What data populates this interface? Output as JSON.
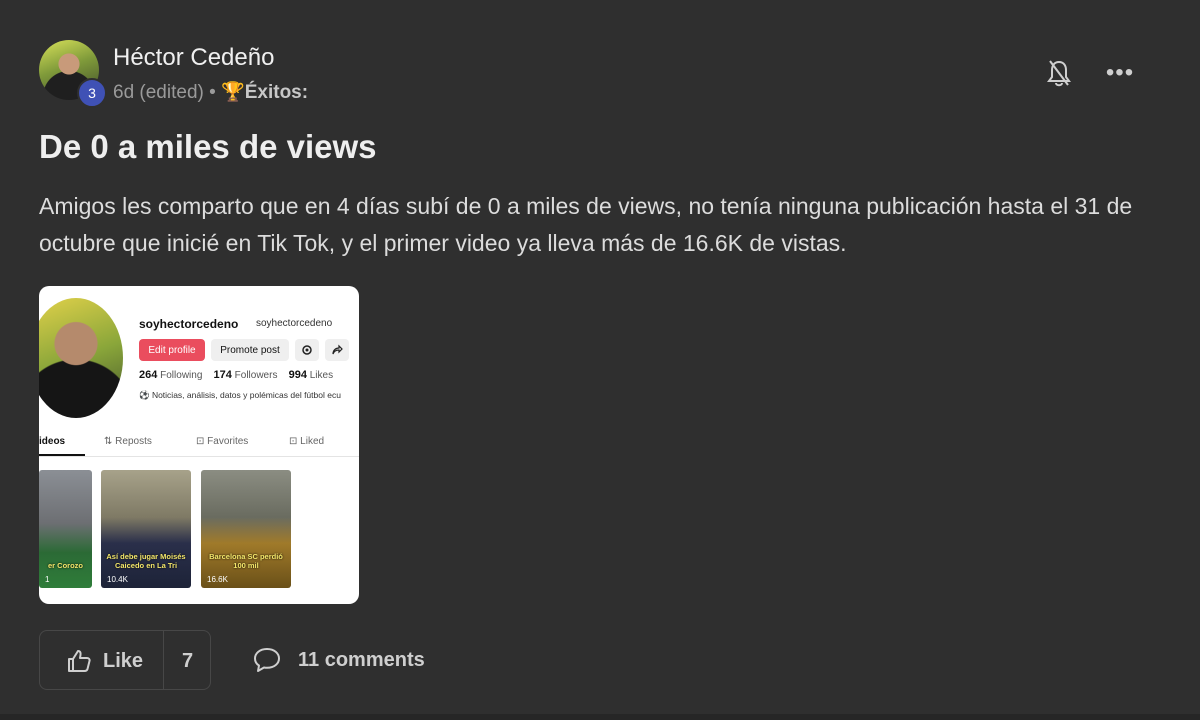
{
  "post": {
    "author": "Héctor Cedeño",
    "level": "3",
    "time": "6d (edited)",
    "separator": "•",
    "category_icon": "🏆",
    "category": "Éxitos:",
    "title": "De 0 a miles de views",
    "body": "Amigos les comparto que en 4 días subí de 0 a miles de views, no tenía ninguna publicación hasta el 31 de octubre que inicié en Tik Tok, y el primer video ya lleva más de 16.6K de vistas."
  },
  "header_icons": {
    "bell": "bell-off-icon",
    "more": "more-dots-icon"
  },
  "screenshot": {
    "username": "soyhectorcedeno",
    "handle": "soyhectorcedeno",
    "edit_profile": "Edit profile",
    "promote_post": "Promote post",
    "stats": {
      "following_count": "264",
      "following_label": "Following",
      "followers_count": "174",
      "followers_label": "Followers",
      "likes_count": "994",
      "likes_label": "Likes"
    },
    "bio": "⚽ Noticias, análisis, datos y polémicas del fútbol ecu",
    "tabs": [
      "ideos",
      "⇅ Reposts",
      "⊡ Favorites",
      "⊡ Liked"
    ],
    "thumbnails": [
      {
        "caption": "er Corozo",
        "views": "1"
      },
      {
        "caption": "Así debe jugar Moisés Caicedo en La Tri",
        "views": "10.4K"
      },
      {
        "caption": "Barcelona SC perdió 100 mil",
        "views": "16.6K"
      }
    ]
  },
  "actions": {
    "like_label": "Like",
    "like_count": "7",
    "comments": "11 comments"
  }
}
